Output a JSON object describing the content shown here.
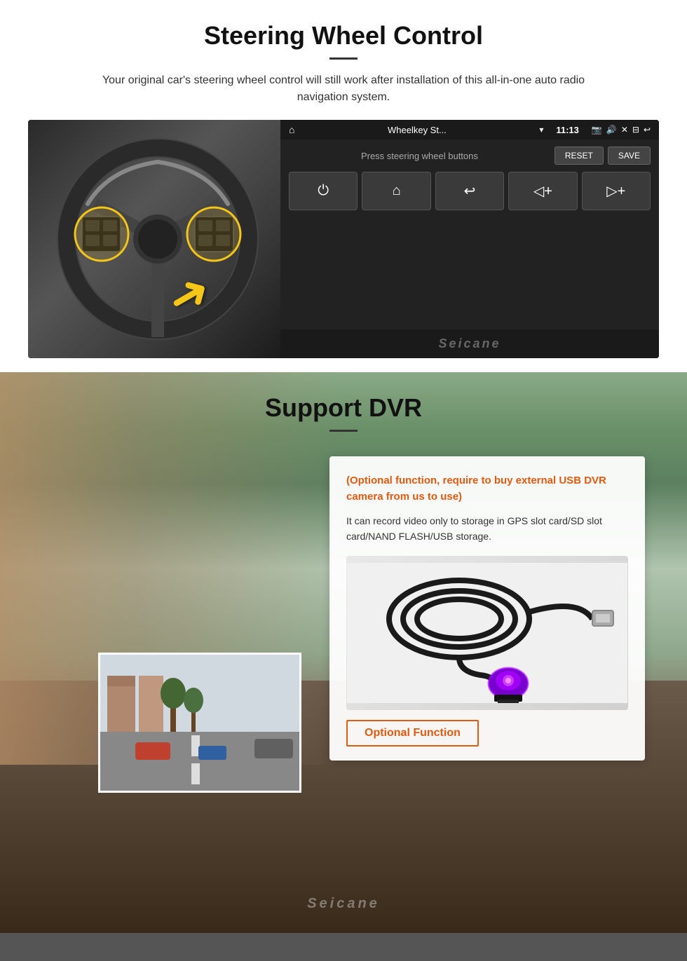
{
  "swc": {
    "title": "Steering Wheel Control",
    "description": "Your original car's steering wheel control will still work after installation of this all-in-one auto radio navigation system.",
    "ui": {
      "appName": "Wheelkey St...",
      "time": "11:13",
      "instruction": "Press steering wheel buttons",
      "resetLabel": "RESET",
      "saveLabel": "SAVE",
      "buttons": [
        "⏻",
        "⌂",
        "↩",
        "◀+",
        "▶+"
      ]
    },
    "seicane": "Seicane"
  },
  "dvr": {
    "title": "Support DVR",
    "cardTitle": "(Optional function, require to buy external USB DVR camera from us to use)",
    "cardText": "It can record video only to storage in GPS slot card/SD slot card/NAND FLASH/USB storage.",
    "optionalLabel": "Optional Function",
    "seicane": "Seicane"
  }
}
